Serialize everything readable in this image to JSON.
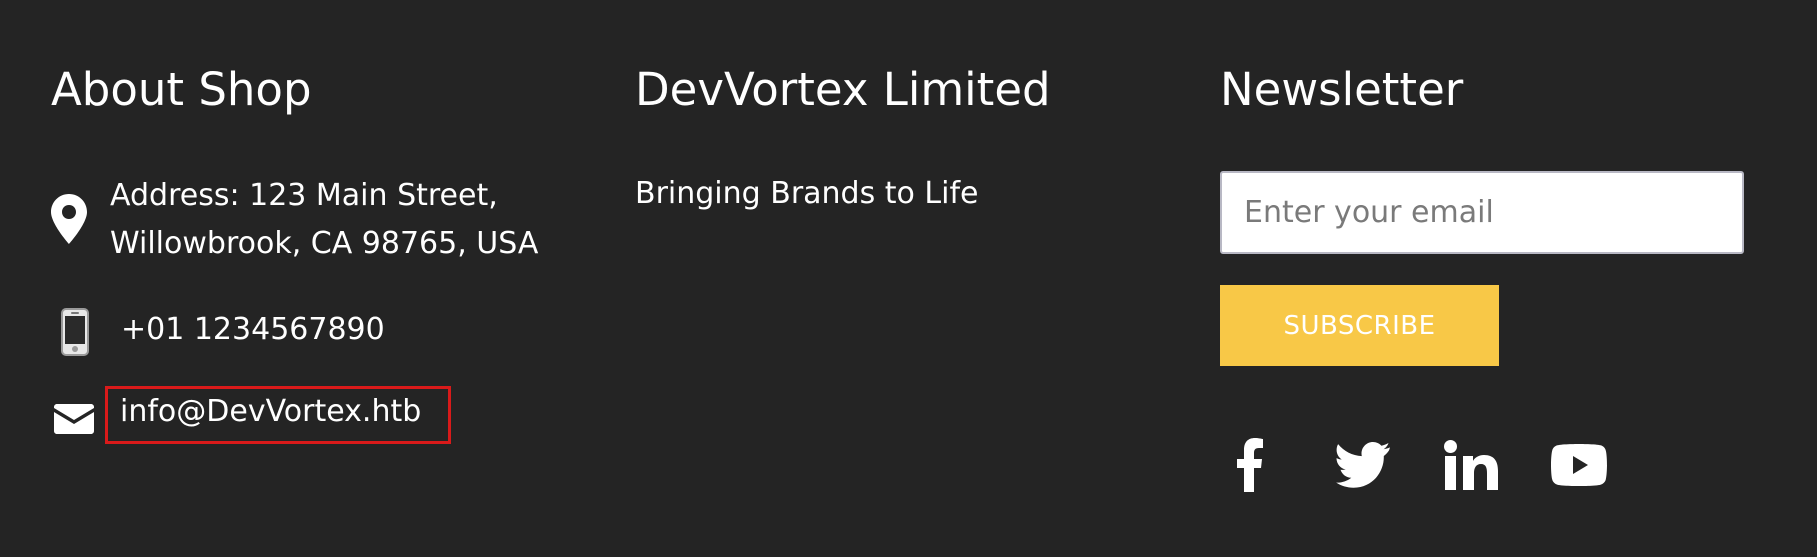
{
  "about": {
    "heading": "About Shop",
    "address_line1": "Address: 123 Main Street,",
    "address_line2": "Willowbrook, CA 98765, USA",
    "phone": "+01 1234567890",
    "email": "info@DevVortex.htb",
    "icons": [
      "map-marker-icon",
      "mobile-phone-icon",
      "envelope-icon"
    ]
  },
  "company": {
    "heading": "DevVortex Limited",
    "tagline": "Bringing Brands to Life"
  },
  "newsletter": {
    "heading": "Newsletter",
    "email_placeholder": "Enter your email",
    "email_value": "",
    "subscribe_label": "SUBSCRIBE"
  },
  "social": [
    "facebook-icon",
    "twitter-icon",
    "linkedin-icon",
    "youtube-icon"
  ],
  "colors": {
    "background": "#242424",
    "text": "#ffffff",
    "accent": "#f8c847",
    "highlight_border": "#d91a1a"
  }
}
